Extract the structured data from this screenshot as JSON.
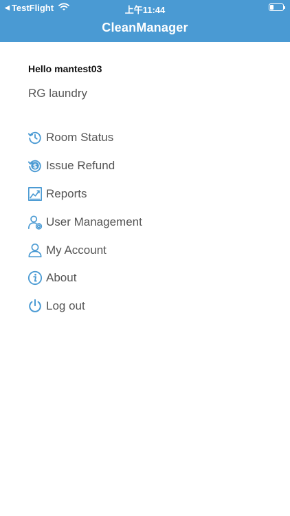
{
  "status_bar": {
    "carrier": "TestFlight",
    "time": "上午11:44",
    "battery_level": 0.3
  },
  "header": {
    "title": "CleanManager",
    "background_color": "#4a9ad3"
  },
  "user": {
    "greeting": "Hello mantest03",
    "store": "RG laundry"
  },
  "menu": {
    "icon_color": "#4a9ad3",
    "items": [
      {
        "label": "Room Status",
        "icon": "history-icon"
      },
      {
        "label": "Issue Refund",
        "icon": "refund-icon"
      },
      {
        "label": "Reports",
        "icon": "report-chart-icon"
      },
      {
        "label": "User Management",
        "icon": "user-settings-icon"
      },
      {
        "label": "My Account",
        "icon": "user-icon"
      },
      {
        "label": "About",
        "icon": "info-icon"
      },
      {
        "label": "Log out",
        "icon": "power-icon"
      }
    ]
  }
}
